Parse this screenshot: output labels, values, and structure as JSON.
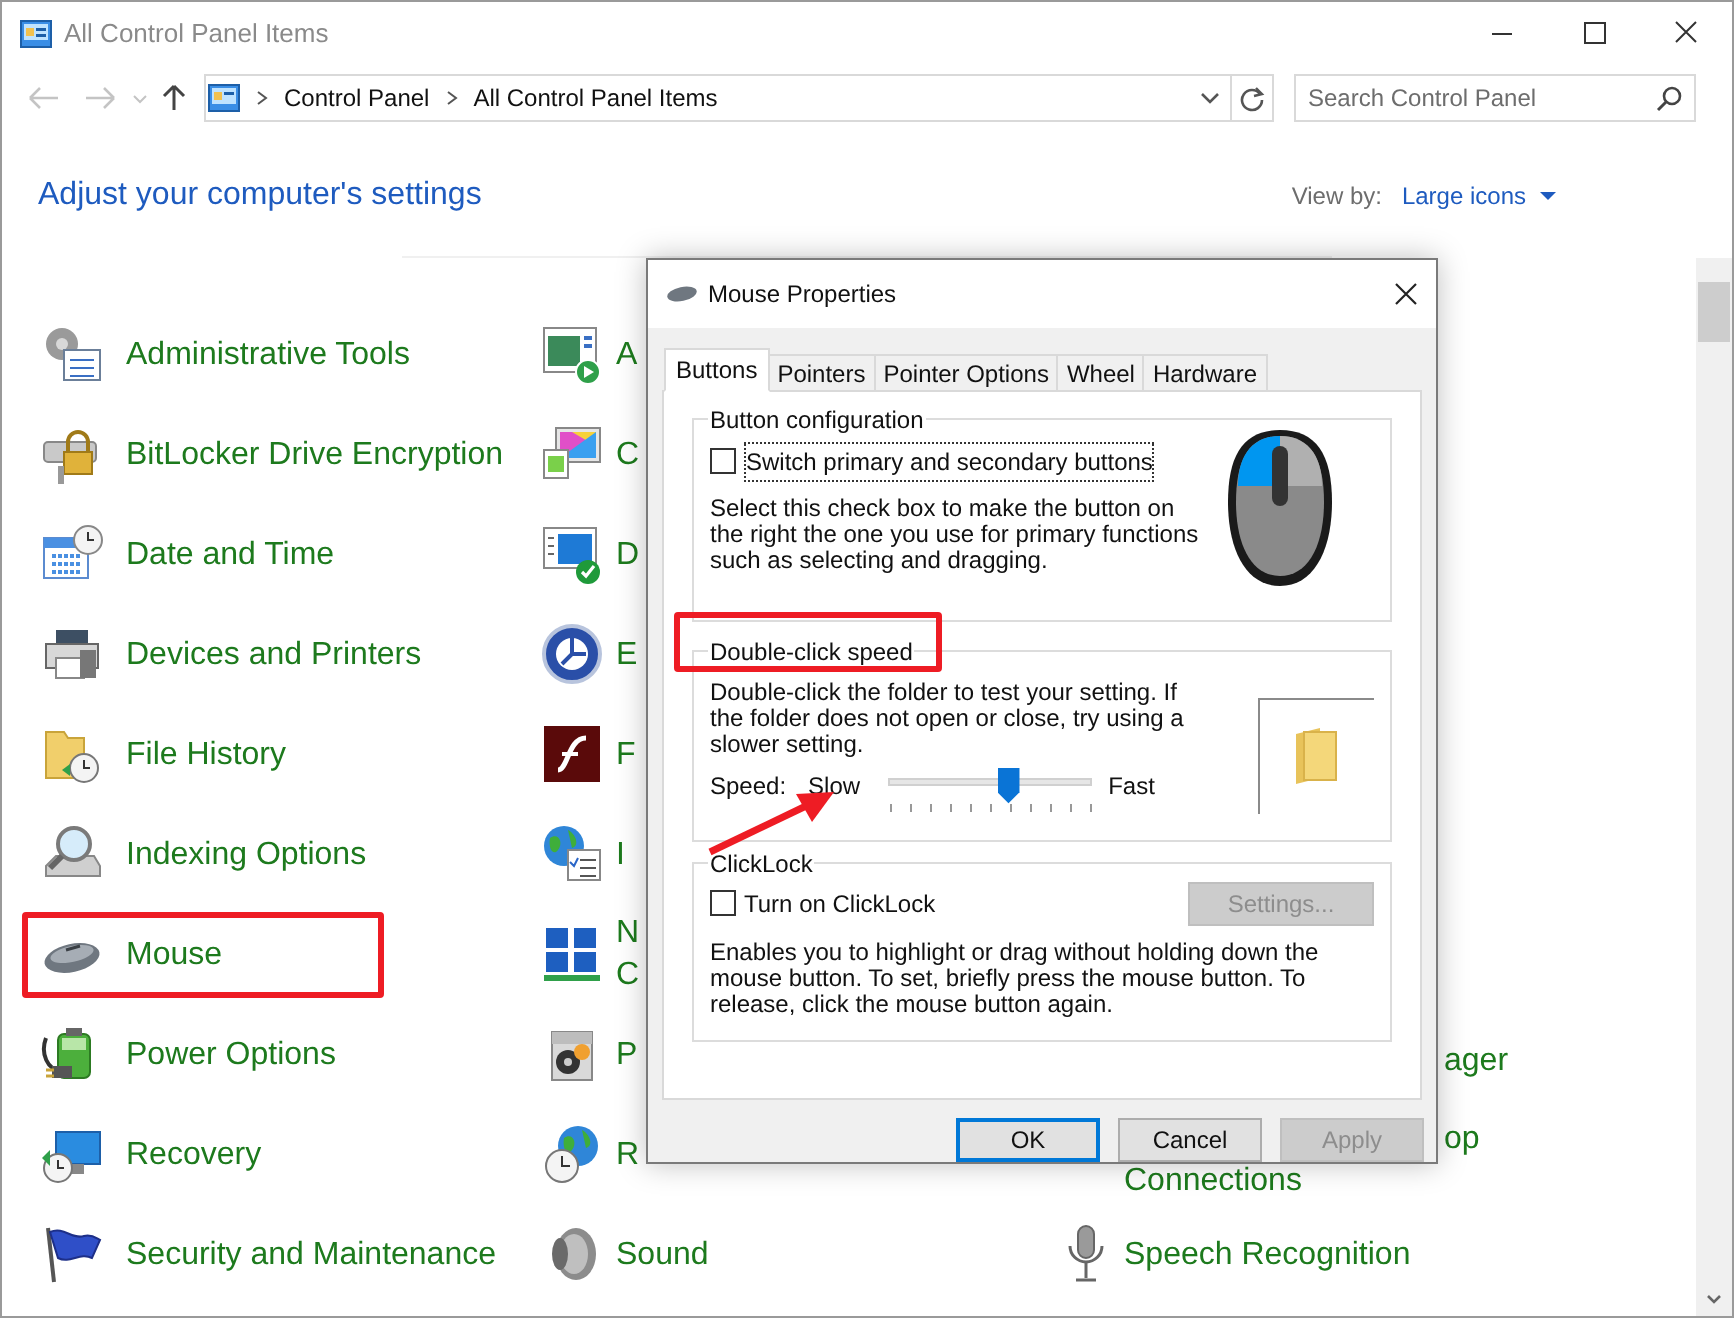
{
  "window": {
    "title": "All Control Panel Items"
  },
  "address_bar": {
    "breadcrumbs": [
      "Control Panel",
      "All Control Panel Items"
    ]
  },
  "search": {
    "placeholder": "Search Control Panel"
  },
  "heading": "Adjust your computer's settings",
  "view_by": {
    "label": "View by:",
    "value": "Large icons"
  },
  "rows": [
    {
      "left": {
        "lines": [
          "Administrative Tools"
        ]
      },
      "middle": {
        "lines": [
          "A"
        ]
      }
    },
    {
      "left": {
        "lines": [
          "BitLocker Drive Encryption"
        ]
      },
      "middle": {
        "lines": [
          "C"
        ]
      }
    },
    {
      "left": {
        "lines": [
          "Date and Time"
        ]
      },
      "middle": {
        "lines": [
          "D"
        ]
      }
    },
    {
      "left": {
        "lines": [
          "Devices and Printers"
        ]
      },
      "middle": {
        "lines": [
          "E"
        ]
      }
    },
    {
      "left": {
        "lines": [
          "File History"
        ]
      },
      "middle": {
        "lines": [
          "F"
        ]
      }
    },
    {
      "left": {
        "lines": [
          "Indexing Options"
        ]
      },
      "middle": {
        "lines": [
          "I"
        ]
      }
    },
    {
      "left": {
        "lines": [
          "Mouse"
        ]
      },
      "middle": {
        "lines": [
          "N",
          "C"
        ]
      }
    },
    {
      "left": {
        "lines": [
          "Power Options"
        ]
      },
      "middle": {
        "lines": [
          "P"
        ]
      },
      "right": {
        "lines": [
          {
            "text": "ager",
            "clipped": true
          }
        ]
      }
    },
    {
      "left": {
        "lines": [
          "Recovery"
        ]
      },
      "middle": {
        "lines": [
          "R"
        ]
      },
      "right": {
        "lines": [
          {
            "text": "op",
            "clipped": true
          },
          {
            "text": "Connections",
            "clipped": false
          }
        ]
      }
    },
    {
      "left": {
        "lines": [
          "Security and Maintenance"
        ]
      },
      "middle": {
        "lines": [
          "Sound"
        ]
      },
      "right": {
        "lines": [
          {
            "text": "Speech Recognition",
            "clipped": false
          }
        ]
      }
    }
  ],
  "dialog": {
    "title": "Mouse Properties",
    "tabs": [
      {
        "label": "Buttons",
        "selected": true
      },
      {
        "label": "Pointers",
        "selected": false
      },
      {
        "label": "Pointer Options",
        "selected": false
      },
      {
        "label": "Wheel",
        "selected": false
      },
      {
        "label": "Hardware",
        "selected": false
      }
    ],
    "button_configuration": {
      "legend": "Button configuration",
      "checkbox": {
        "label": "Switch primary and secondary buttons",
        "checked": false
      },
      "description": "Select this check box to make the button on the right the one you use for primary functions such as selecting and dragging."
    },
    "double_click_speed": {
      "legend": "Double-click speed",
      "description": "Double-click the folder to test your setting. If the folder does not open or close, try using a slower setting.",
      "speed_label": "Speed:",
      "slow": "Slow",
      "fast": "Fast",
      "level": 0.59
    },
    "clicklock": {
      "legend": "ClickLock",
      "checkbox": {
        "label": "Turn on ClickLock",
        "checked": false
      },
      "settings_button": {
        "label": "Settings...",
        "disabled": true
      },
      "description": "Enables you to highlight or drag without holding down the mouse button. To set, briefly press the mouse button. To release, click the mouse button again."
    },
    "buttons": [
      {
        "label": "OK",
        "kind": "default",
        "disabled": false
      },
      {
        "label": "Cancel",
        "kind": "normal",
        "disabled": false
      },
      {
        "label": "Apply",
        "kind": "normal",
        "disabled": true
      }
    ]
  },
  "annotations": [
    {
      "kind": "box"
    },
    {
      "kind": "box"
    },
    {
      "kind": "arrow"
    }
  ]
}
